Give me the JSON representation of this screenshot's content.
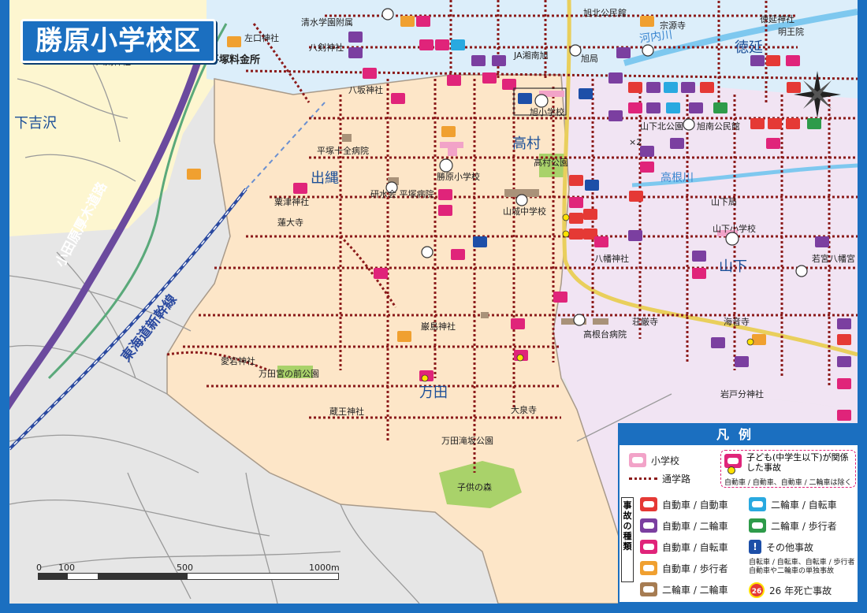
{
  "title": "勝原小学校区",
  "area_labels": {
    "takamura": "高村",
    "izunawa": "出縄",
    "mangata": "万田",
    "yamashita": "山下",
    "tokunobu": "徳延",
    "shimokizawa": "下吉沢"
  },
  "railways": {
    "odawara_atsugi": "小田原厚木道路",
    "tokaido_shinkansen": "東海道新幹線"
  },
  "rivers": {
    "kouchi": "河内川",
    "takane": "高根川"
  },
  "places": {
    "hiratsuka_ryokin": "平塚料金所",
    "shimizu_gakuen": "清水学園附属",
    "hachikenjinja_top": "八剣神社",
    "hachikenjinja_left": "八剣神社",
    "hachizaka": "八坂神社",
    "ja_shonan": "JA湘南旭",
    "asahi": "旭局",
    "asahi_sho": "旭小学校",
    "sanka_koen": "山下北公園",
    "asahi_minami": "旭南公民館",
    "takamura_koen": "高村公園",
    "hiratsuka_juji": "平塚十全病院",
    "mizunokai": "研水会 平塚病院",
    "katsuhara_sho": "勝原小学校",
    "yamashiro_chu": "山城中学校",
    "awatsu": "粟津神社",
    "rendai": "蓮大寺",
    "yamashita_kyoku": "山下局",
    "yamashita_sho": "山下小学校",
    "hachiman": "八幡神社",
    "wakamiya": "若宮八幡宮",
    "iwashima": "巌島神社",
    "shogonji": "荘厳寺",
    "kaionji": "海音寺",
    "takanedai": "高根台病院",
    "atago": "愛宕神社",
    "mangata_mae": "万田宮の前公園",
    "zao": "蔵王神社",
    "daisenji": "大泉寺",
    "mangata_takisaka": "万田滝坂公園",
    "kodomo_no_mori": "子供の森",
    "iwatobun": "岩戸分神社",
    "tokunobu_jinja": "徳延神社",
    "sogenji": "宗源寺",
    "myoouin": "明王院",
    "kouminkan": "旭北公民館",
    "sakou": "左口神社",
    "x2": "×2"
  },
  "scale": {
    "ticks": [
      "0",
      "100",
      "500",
      "1000m"
    ]
  },
  "legend": {
    "header": "凡例",
    "school": "小学校",
    "route": "通学路",
    "child_accident": "子ども(中学生以下)が関係した事故",
    "child_note": "自動車 / 自動車、自動車 / 二輪車は除く",
    "kind_label": "事故の種類",
    "items_left": [
      "自動車 / 自動車",
      "自動車 / 二輪車",
      "自動車 / 自転車",
      "自動車 / 歩行者",
      "二輪車 / 二輪車"
    ],
    "items_right": [
      "二輪車 / 自転車",
      "二輪車 / 歩行者",
      "その他事故"
    ],
    "other_note": "自転車 / 自転車、自転車 / 歩行者 自動車や二輪車の単独事故",
    "fatal_badge": "26",
    "fatal": "26 年死亡事故"
  },
  "colors": {
    "school_area": "#fde6c8",
    "north_area": "#dceefa",
    "east_area": "#f1e4f3",
    "west_area": "#fdf6d0",
    "route": "#8b1a1a",
    "frame": "#1b6fc0",
    "car_car": "#e53935",
    "car_moto": "#7b3fa0",
    "car_bike": "#e0247a",
    "car_ped": "#f0a030",
    "moto_moto": "#a67c52",
    "moto_bike": "#29a9e0",
    "moto_ped": "#2e9b4a",
    "other": "#1d4fa8"
  }
}
